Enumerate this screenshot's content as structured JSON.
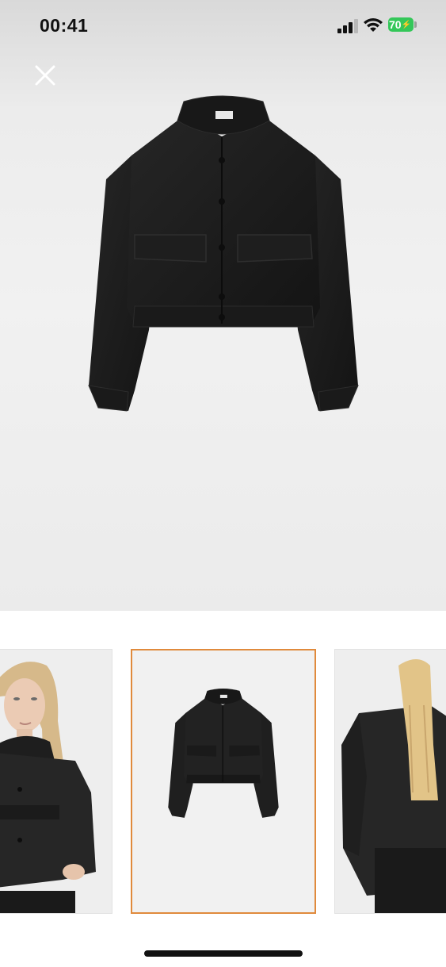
{
  "status_bar": {
    "time": "00:41",
    "battery": "70"
  },
  "hero": {
    "image_icon": "jacket-product-photo",
    "close_icon": "close-icon"
  },
  "thumbnails": [
    {
      "name": "model-front-photo",
      "selected": false
    },
    {
      "name": "jacket-product-photo",
      "selected": true
    },
    {
      "name": "model-back-photo",
      "selected": false
    }
  ],
  "colors": {
    "selected_border": "#e08a3c",
    "battery_green": "#34c759",
    "jacket": "#1c1c1c"
  }
}
